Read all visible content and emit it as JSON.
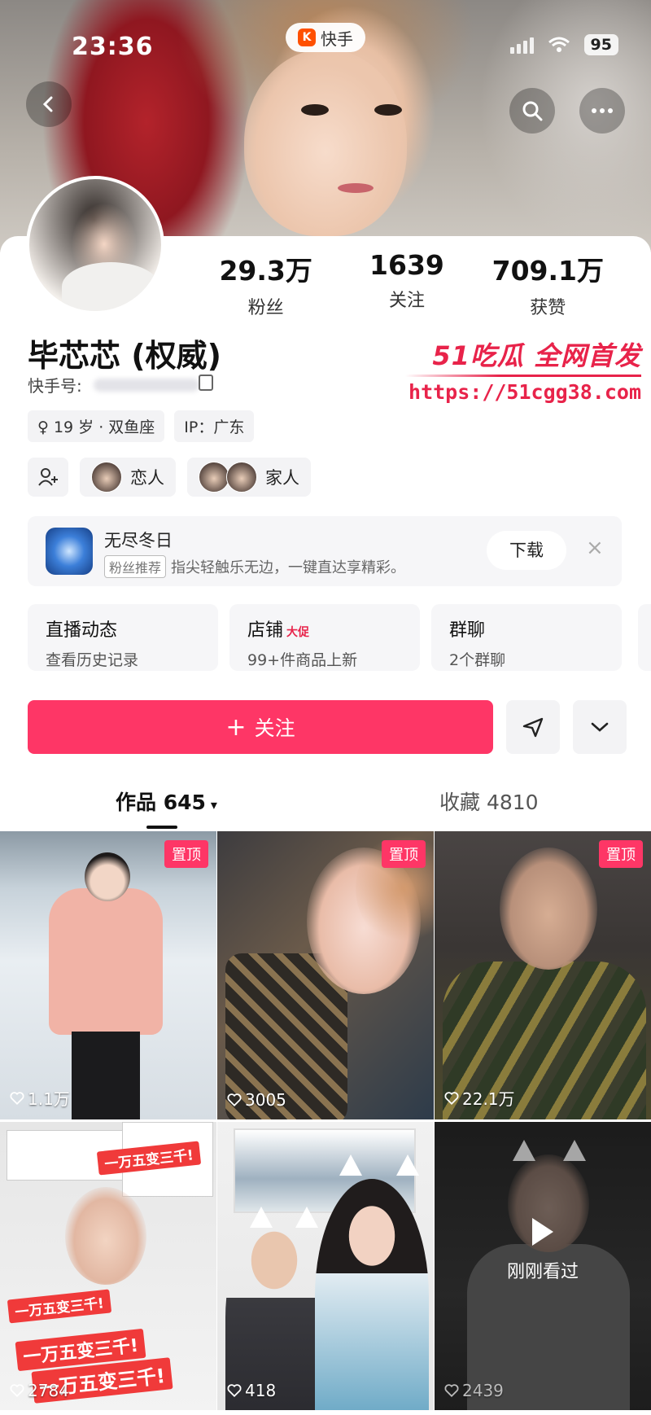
{
  "status_bar": {
    "time": "23:36",
    "battery": "95"
  },
  "app_pill": {
    "logo": "K",
    "label": "快手"
  },
  "profile": {
    "stats": [
      {
        "value": "29.3万",
        "label": "粉丝"
      },
      {
        "value": "1639",
        "label": "关注"
      },
      {
        "value": "709.1万",
        "label": "获赞"
      }
    ],
    "name": "毕芯芯 (权威)",
    "kuaishou_id_label": "快手号:",
    "tags": [
      "♀ 19 岁 · 双鱼座",
      "IP：广东"
    ],
    "relations": [
      {
        "label": "恋人"
      },
      {
        "label": "家人"
      }
    ]
  },
  "watermark": {
    "title": "51吃瓜 全网首发",
    "url": "https://51cgg38.com"
  },
  "promo": {
    "title": "无尽冬日",
    "tag": "粉丝推荐",
    "desc": "指尖轻触乐无边，一键直达享精彩。",
    "download": "下载",
    "close": "×"
  },
  "tiles": [
    {
      "title": "直播动态",
      "badge": "",
      "sub": "查看历史记录"
    },
    {
      "title": "店铺",
      "badge": "大促",
      "sub": "99+件商品上新"
    },
    {
      "title": "群聊",
      "badge": "",
      "sub": "2个群聊"
    }
  ],
  "actions": {
    "follow": "关注",
    "plus": "+"
  },
  "tabs": {
    "works": "作品 645",
    "caret": "▾",
    "favorites": "收藏 4810"
  },
  "videos": [
    {
      "pinned": "置顶",
      "likes": "1.1万"
    },
    {
      "pinned": "置顶",
      "likes": "3005"
    },
    {
      "pinned": "置顶",
      "likes": "22.1万"
    },
    {
      "likes": "2784",
      "overlay": [
        "一万五变三千!",
        "一万五变三千!",
        "一万五变三千!",
        "一万五变三千!"
      ]
    },
    {
      "likes": "418"
    },
    {
      "likes": "2439",
      "watched": "刚刚看过"
    }
  ],
  "colors": {
    "accent": "#fe3666",
    "watermark": "#e8234a"
  }
}
